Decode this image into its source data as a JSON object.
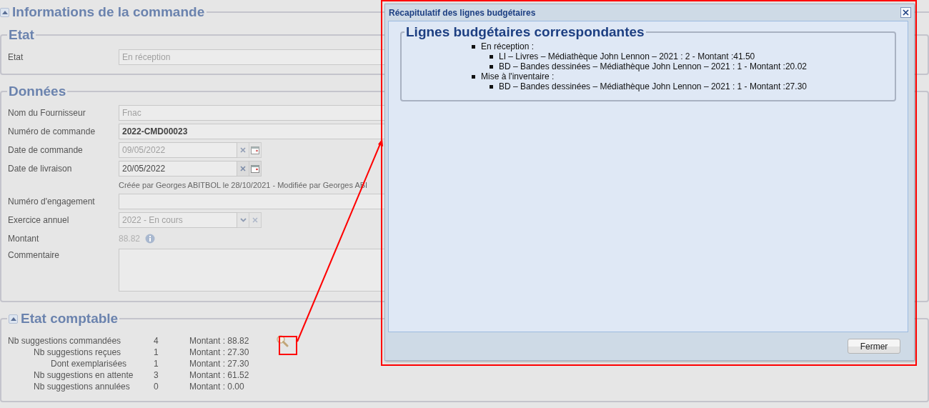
{
  "header": {
    "title": "Informations de la commande",
    "expanded": true
  },
  "etat_section": {
    "legend": "Etat",
    "fields": [
      {
        "kind": "text",
        "label": "Etat",
        "value": "En réception",
        "disabled": true
      }
    ]
  },
  "donnees_section": {
    "legend": "Données",
    "fields": [
      {
        "kind": "text",
        "label": "Nom du Fournisseur",
        "value": "Fnac",
        "disabled": true
      },
      {
        "kind": "text",
        "label": "Numéro de commande",
        "value": "2022-CMD00023",
        "disabled": false
      },
      {
        "kind": "date",
        "label": "Date de commande",
        "value": "09/05/2022",
        "disabled": true
      },
      {
        "kind": "date",
        "label": "Date de livraison",
        "value": "20/05/2022",
        "disabled": false
      },
      {
        "kind": "note",
        "text": "Créée par Georges ABITBOL le 28/10/2021 - Modifiée par Georges ABI"
      },
      {
        "kind": "text",
        "label": "Numéro d'engagement"
      },
      {
        "kind": "select",
        "label": "Exercice annuel",
        "value": "2022 - En cours",
        "disabled": true
      },
      {
        "kind": "amount",
        "label": "Montant",
        "value": "88.82",
        "disabled": true
      },
      {
        "kind": "textarea",
        "label": "Commentaire"
      }
    ]
  },
  "comptable_section": {
    "legend": "Etat comptable",
    "expanded": true,
    "rows": [
      {
        "label": "Nb suggestions commandées",
        "count": "4",
        "amount": "Montant : 88.82",
        "children": [
          {
            "label": "Nb suggestions reçues",
            "count": "1",
            "amount": "Montant : 27.30",
            "children": [
              {
                "label": "Dont exemplarisées",
                "count": "1",
                "amount": "Montant : 27.30"
              }
            ]
          },
          {
            "label": "Nb suggestions en attente",
            "count": "3",
            "amount": "Montant : 61.52"
          },
          {
            "label": "Nb suggestions annulées",
            "count": "0",
            "amount": "Montant : 0.00"
          }
        ]
      }
    ]
  },
  "dialog": {
    "title": "Récapitulatif des lignes budgétaires",
    "legend": "Lignes budgétaires correspondantes",
    "items": [
      {
        "text": "En réception :",
        "children": [
          {
            "text": "LI – Livres – Médiathèque John Lennon – 2021 : 2 - Montant :41.50"
          },
          {
            "text": "BD – Bandes dessinées – Médiathèque John Lennon – 2021 : 1 - Montant :20.02"
          }
        ]
      },
      {
        "text": "Mise à l'inventaire :",
        "children": [
          {
            "text": "BD – Bandes dessinées – Médiathèque John Lennon – 2021 : 1 - Montant :27.30"
          }
        ]
      }
    ],
    "buttons": [
      "Fermer"
    ]
  }
}
